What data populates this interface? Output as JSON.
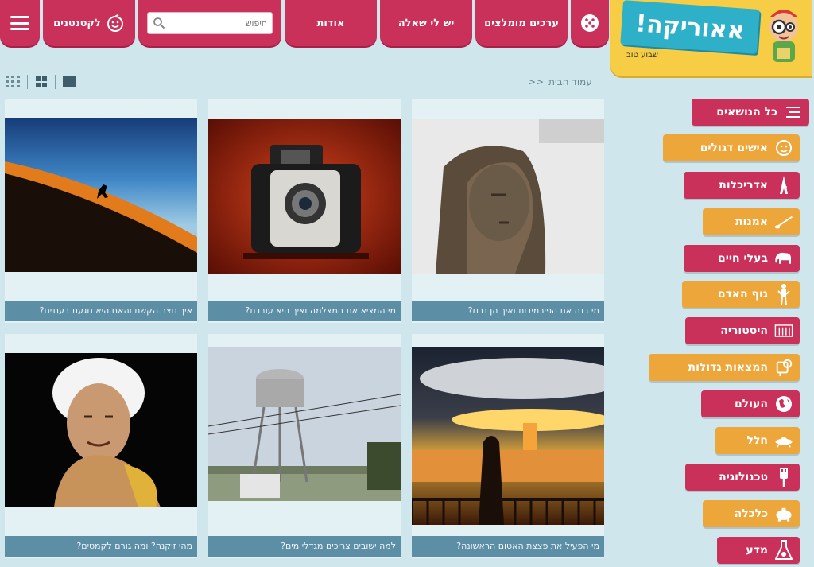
{
  "nav": {
    "menu_icon": "hamburger-icon",
    "kids_label": "לקטנטנים",
    "search_placeholder": "חיפוש",
    "about_label": "אודות",
    "ask_label": "יש לי שאלה",
    "daily_label": "ערכים מומלצים",
    "random_icon": "dice-icon"
  },
  "logo": {
    "text": "אאוריקה!",
    "tagline": "שבוע טוב"
  },
  "breadcrumb": {
    "home": "עמוד הבית",
    "separator": "<<"
  },
  "colors": {
    "pink": "#c9305a",
    "orange": "#eda63a",
    "caption_bg": "#5c8ea6",
    "page_bg": "#cfe6ec",
    "logo_yellow": "#f6cd45",
    "logo_banner": "#2eb0c8"
  },
  "cards": [
    {
      "caption": "איך נוצר הקשת והאם היא נוגעת בעננים?",
      "image": "skydiver-horizon"
    },
    {
      "caption": "מי המציא את המצלמה ואיך היא עובדת?",
      "image": "vintage-camera"
    },
    {
      "caption": "מי בנה את הפירמידות ואיך הן נבנו?",
      "image": "pharaoh-statue"
    },
    {
      "caption": "מהי זיקנה? ומה גורם לקמטים?",
      "image": "elderly-woman"
    },
    {
      "caption": "למה ישובים צריכים מגדלי מים?",
      "image": "water-tower"
    },
    {
      "caption": "מי הפעיל את פצצת האטום הראשונה?",
      "image": "mushroom-cloud"
    }
  ],
  "categories": [
    {
      "label": "כל הנושאים",
      "icon": "list-icon",
      "color": "pink"
    },
    {
      "label": "אישים דגולים",
      "icon": "person-face-icon",
      "color": "orange"
    },
    {
      "label": "אדריכלות",
      "icon": "eiffel-tower-icon",
      "color": "pink"
    },
    {
      "label": "אמנות",
      "icon": "paintbrush-icon",
      "color": "orange"
    },
    {
      "label": "בעלי חיים",
      "icon": "elephant-icon",
      "color": "pink"
    },
    {
      "label": "גוף האדם",
      "icon": "human-body-icon",
      "color": "orange"
    },
    {
      "label": "היסטוריה",
      "icon": "temple-icon",
      "color": "pink"
    },
    {
      "label": "המצאות גדולות",
      "icon": "inventions-icon",
      "color": "orange"
    },
    {
      "label": "העולם",
      "icon": "globe-icon",
      "color": "pink"
    },
    {
      "label": "חלל",
      "icon": "spaceship-icon",
      "color": "orange"
    },
    {
      "label": "טכנולוגיה",
      "icon": "usb-plug-icon",
      "color": "pink"
    },
    {
      "label": "כלכלה",
      "icon": "piggy-bank-icon",
      "color": "orange"
    },
    {
      "label": "מדע",
      "icon": "flask-icon",
      "color": "pink"
    }
  ]
}
